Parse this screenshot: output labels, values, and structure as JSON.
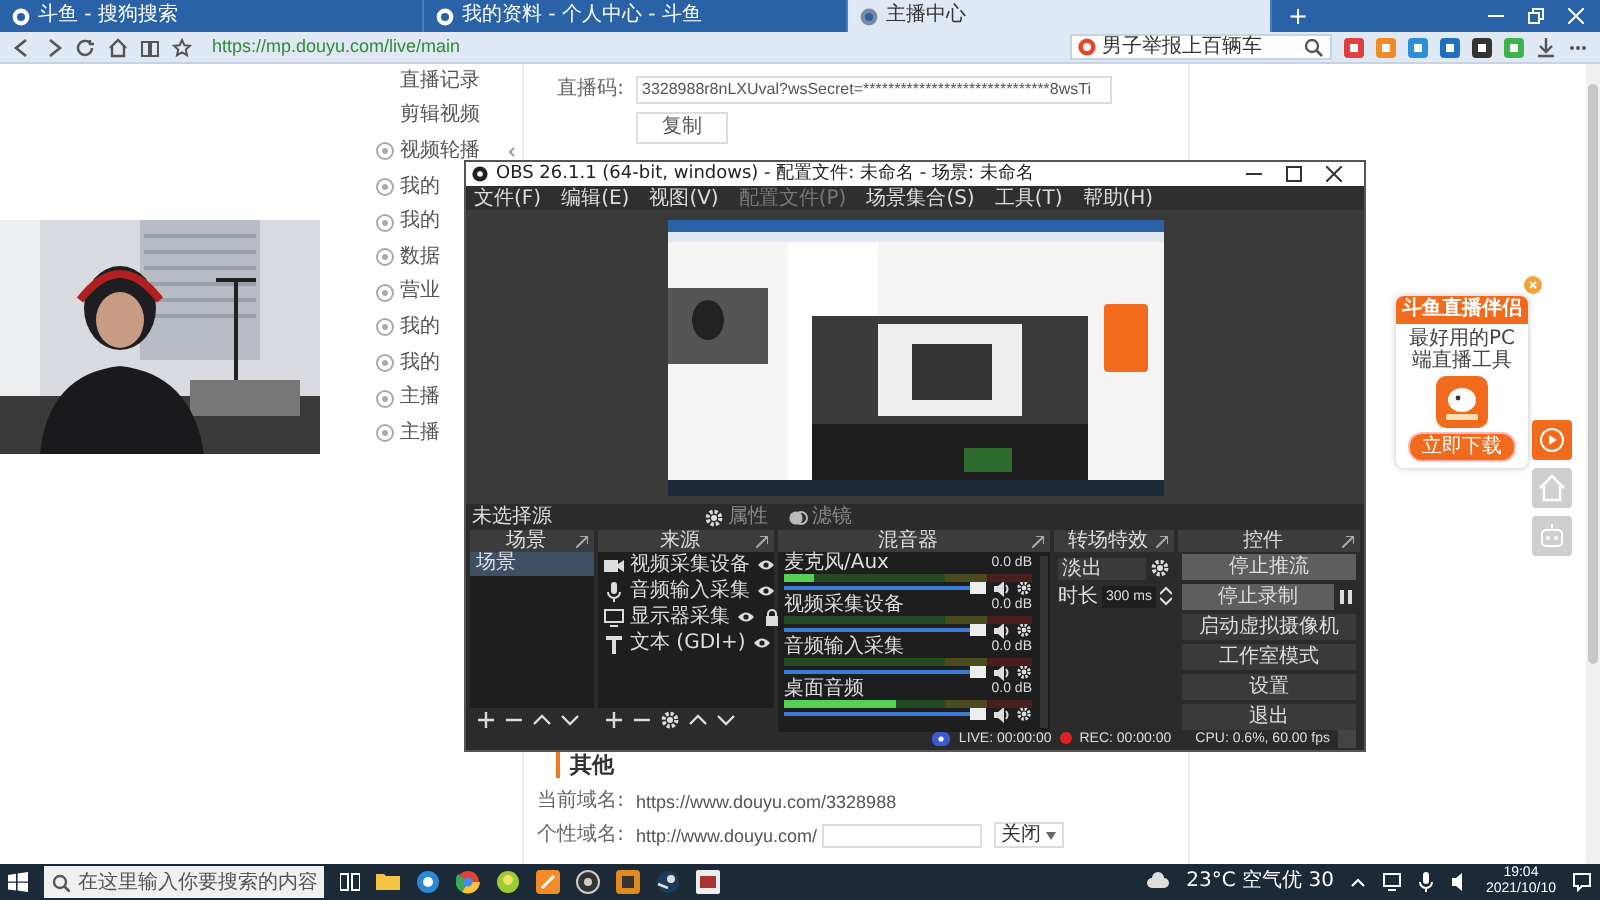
{
  "browser": {
    "tabs": [
      {
        "title": "斗鱼 - 搜狗搜索",
        "selected": false
      },
      {
        "title": "我的资料 - 个人中心 - 斗鱼",
        "selected": false
      },
      {
        "title": "主播中心",
        "selected": true
      }
    ],
    "new_tab": "+",
    "url": "https://mp.douyu.com/live/main",
    "search": "男子举报上百辆车"
  },
  "sidebar": {
    "items": [
      {
        "label": "直播记录",
        "kind": "plain",
        "expandable": false
      },
      {
        "label": "剪辑视频",
        "kind": "plain",
        "expandable": false
      },
      {
        "label": "视频轮播",
        "kind": "group",
        "expandable": true
      },
      {
        "label": "我的",
        "kind": "group",
        "expandable": false
      },
      {
        "label": "我的",
        "kind": "group",
        "expandable": false
      },
      {
        "label": "数据",
        "kind": "group",
        "expandable": false
      },
      {
        "label": "营业",
        "kind": "group",
        "expandable": false
      },
      {
        "label": "我的",
        "kind": "group",
        "expandable": false
      },
      {
        "label": "我的",
        "kind": "group",
        "expandable": false
      },
      {
        "label": "主播",
        "kind": "group",
        "expandable": false
      },
      {
        "label": "主播",
        "kind": "group",
        "expandable": false
      }
    ]
  },
  "stream_code": {
    "label": "直播码:",
    "value": "3328988r8nLXUval?wsSecret=******************************8wsTi",
    "button": "复制"
  },
  "other": {
    "heading": "其他",
    "current_domain": {
      "label": "当前域名:",
      "value": "https://www.douyu.com/3328988"
    },
    "custom_domain": {
      "label": "个性域名:",
      "prefix": "http://www.douyu.com/",
      "toggle": "关闭"
    }
  },
  "obs": {
    "title": "OBS 26.1.1 (64-bit, windows) - 配置文件: 未命名 - 场景: 未命名",
    "menu": [
      {
        "label": "文件(F)",
        "disabled": false
      },
      {
        "label": "编辑(E)",
        "disabled": false
      },
      {
        "label": "视图(V)",
        "disabled": false
      },
      {
        "label": "配置文件(P)",
        "disabled": true
      },
      {
        "label": "场景集合(S)",
        "disabled": false
      },
      {
        "label": "工具(T)",
        "disabled": false
      },
      {
        "label": "帮助(H)",
        "disabled": false
      }
    ],
    "selection": "未选择源",
    "tools": [
      {
        "label": "属性",
        "kind": "properties",
        "disabled": true
      },
      {
        "label": "滤镜",
        "kind": "filters",
        "disabled": true
      }
    ],
    "scenes": {
      "title": "场景",
      "items": [
        {
          "label": "场景",
          "selected": true
        }
      ]
    },
    "sources": {
      "title": "来源",
      "items": [
        {
          "label": "视频采集设备",
          "kind": "camera"
        },
        {
          "label": "音频输入采集",
          "kind": "mic"
        },
        {
          "label": "显示器采集",
          "kind": "monitor"
        },
        {
          "label": "文本 (GDI+)",
          "kind": "text"
        }
      ]
    },
    "mixer": {
      "title": "混音器",
      "channels": [
        {
          "name": "麦克风/Aux",
          "reading": "0.0 dB",
          "level": 0.12,
          "volume": {
            "level": 1
          }
        },
        {
          "name": "视频采集设备",
          "reading": "0.0 dB",
          "level": 0,
          "volume": {
            "level": 1
          }
        },
        {
          "name": "音频输入采集",
          "reading": "0.0 dB",
          "level": 0,
          "volume": {
            "level": 1
          }
        },
        {
          "name": "桌面音频",
          "reading": "0.0 dB",
          "level": 0.45,
          "volume": {
            "level": 1
          }
        }
      ]
    },
    "transitions": {
      "title": "转场特效",
      "type": "淡出",
      "duration_label": "时长",
      "duration": "300 ms"
    },
    "controls": {
      "title": "控件",
      "buttons": [
        {
          "label": "停止推流",
          "active": true,
          "kind": "plain"
        },
        {
          "label": "停止录制",
          "active": true,
          "kind": "record"
        },
        {
          "label": "启动虚拟摄像机",
          "active": false,
          "kind": "plain"
        },
        {
          "label": "工作室模式",
          "active": false,
          "kind": "plain"
        },
        {
          "label": "设置",
          "active": false,
          "kind": "plain"
        },
        {
          "label": "退出",
          "active": false,
          "kind": "plain"
        }
      ]
    },
    "status": {
      "live": "LIVE: 00:00:00",
      "rec": "REC: 00:00:00",
      "cpu": "CPU: 0.6%, 60.00 fps"
    }
  },
  "promo": {
    "title": "斗鱼直播伴侣",
    "subtitle": "最好用的PC端直播工具",
    "button": "立即下载"
  },
  "taskbar": {
    "search_placeholder": "在这里输入你要搜索的内容",
    "weather": "23°C 空气优 30",
    "time": "19:04",
    "date": "2021/10/10"
  }
}
